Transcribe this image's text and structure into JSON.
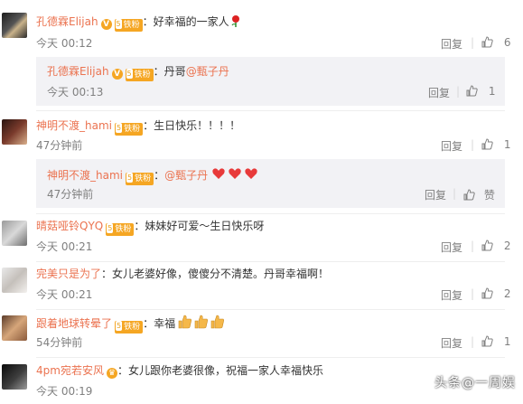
{
  "comments": [
    {
      "name": "孔德霖Elijah",
      "text": "好幸福的一家人",
      "time": "今天 00:12",
      "reply": "回复",
      "likes": "6",
      "sub_reply": {
        "name": "孔德霖Elijah",
        "text": "丹哥",
        "mention": "@甄子丹",
        "time": "今天 00:13",
        "reply": "回复",
        "likes": "1"
      }
    },
    {
      "name": "神明不渡_hami",
      "text": "生日快乐！！！！",
      "time": "47分钟前",
      "reply": "回复",
      "likes": "1",
      "sub_reply": {
        "name": "神明不渡_hami",
        "mention": "@甄子丹",
        "time": "47分钟前",
        "reply": "回复",
        "likes": "赞"
      }
    },
    {
      "name": "晴菇哑铃QYQ",
      "text": "妹妹好可爱～生日快乐呀",
      "time": "今天 00:21",
      "reply": "回复",
      "likes": "2"
    },
    {
      "name": "完美只是为了",
      "text": "女儿老婆好像，傻傻分不清楚。丹哥幸福啊！",
      "time": "今天 00:21",
      "reply": "回复",
      "likes": "2"
    },
    {
      "name": "跟着地球转晕了",
      "text": "幸福",
      "time": "54分钟前",
      "reply": "回复",
      "likes": "1"
    },
    {
      "name": "4pm宛若安风",
      "text": "女儿跟你老婆很像，祝福一家人幸福快乐",
      "time": "今天 00:19"
    }
  ],
  "badge_label": "铁粉",
  "badge_level": "5",
  "watermark": "头条@一周娱",
  "colors": {
    "name": "#eb7350",
    "text": "#333333",
    "time": "#808080",
    "reply_bg": "#f2f2f5"
  }
}
